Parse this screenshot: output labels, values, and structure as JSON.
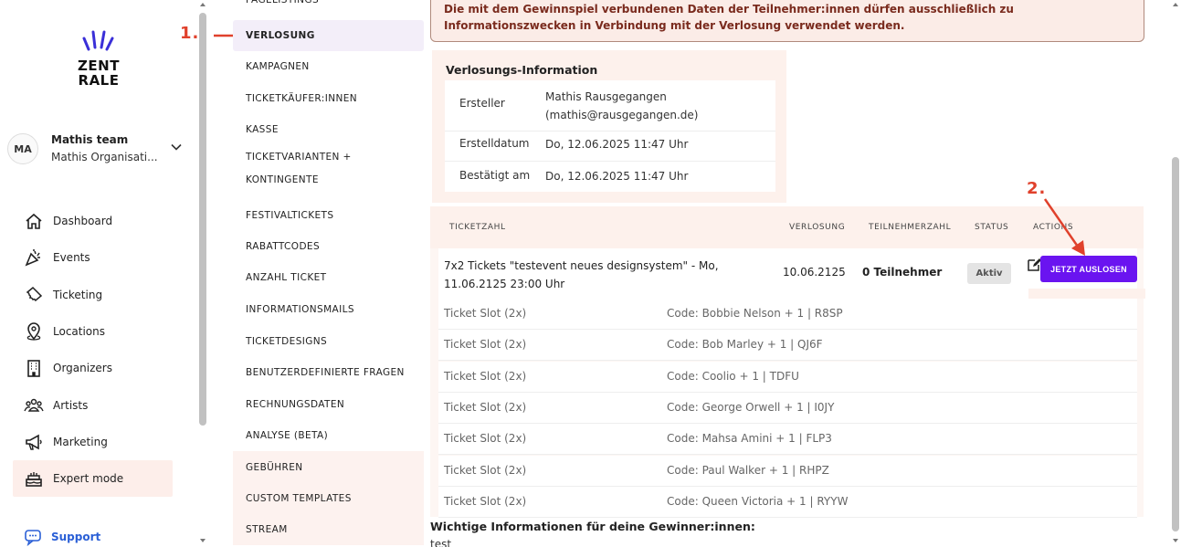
{
  "brand": {
    "logo_text": "ZENT\nRALE"
  },
  "team": {
    "initials": "MA",
    "name": "Mathis team",
    "org": "Mathis Organisati..."
  },
  "sidebar": {
    "items": [
      {
        "label": "Dashboard",
        "icon": "home-icon"
      },
      {
        "label": "Events",
        "icon": "party-icon"
      },
      {
        "label": "Ticketing",
        "icon": "ticket-icon"
      },
      {
        "label": "Locations",
        "icon": "location-pin-icon"
      },
      {
        "label": "Organizers",
        "icon": "building-icon"
      },
      {
        "label": "Artists",
        "icon": "group-icon"
      },
      {
        "label": "Marketing",
        "icon": "megaphone-icon"
      },
      {
        "label": "Expert mode",
        "icon": "cake-icon"
      }
    ],
    "support_label": "Support"
  },
  "submenu": {
    "items": [
      "PAGELISTINGS",
      "VERLOSUNG",
      "KAMPAGNEN",
      "TICKETKÄUFER:INNEN",
      "KASSE",
      "TICKETVARIANTEN + KONTINGENTE",
      "FESTIVALTICKETS",
      "RABATTCODES",
      "ANZAHL TICKET",
      "INFORMATIONSMAILS",
      "TICKETDESIGNS",
      "BENUTZERDEFINIERTE FRAGEN",
      "RECHNUNGSDATEN",
      "ANALYSE (BETA)",
      "GEBÜHREN",
      "CUSTOM TEMPLATES",
      "STREAM"
    ],
    "active": "VERLOSUNG"
  },
  "notice": {
    "text": "Die mit dem Gewinnspiel verbundenen Daten der Teilnehmer:innen dürfen ausschließlich zu Informationszwecken in Verbindung mit der Verlosung verwendet werden."
  },
  "info": {
    "title": "Verlosungs-Information",
    "rows": [
      {
        "key": "Ersteller",
        "value_line1": "Mathis Rausgegangen",
        "value_line2": "(mathis@rausgegangen.de)"
      },
      {
        "key": "Erstelldatum",
        "value_line1": "Do, 12.06.2025 11:47 Uhr"
      },
      {
        "key": "Bestätigt am",
        "value_line1": "Do, 12.06.2025 11:47 Uhr"
      }
    ]
  },
  "table": {
    "headers": {
      "ticket": "TICKETZAHL",
      "draw": "VERLOSUNG",
      "participants": "TEILNEHMERZAHL",
      "status": "STATUS",
      "actions": "ACTIONS"
    },
    "main_row": {
      "title": "7x2 Tickets \"testevent neues designsystem\" - Mo, 11.06.2125 23:00 Uhr",
      "draw_date": "10.06.2125",
      "participants": "0 Teilnehmer",
      "status": "Aktiv",
      "button": "JETZT AUSLOSEN"
    },
    "slots": [
      {
        "name": "Ticket Slot (2x)",
        "code": "Code: Bobbie Nelson + 1 | R8SP"
      },
      {
        "name": "Ticket Slot (2x)",
        "code": "Code: Bob Marley + 1 | QJ6F"
      },
      {
        "name": "Ticket Slot (2x)",
        "code": "Code: Coolio + 1 | TDFU"
      },
      {
        "name": "Ticket Slot (2x)",
        "code": "Code: George Orwell + 1 | I0JY"
      },
      {
        "name": "Ticket Slot (2x)",
        "code": "Code: Mahsa Amini + 1 | FLP3"
      },
      {
        "name": "Ticket Slot (2x)",
        "code": "Code: Paul Walker + 1 | RHPZ"
      },
      {
        "name": "Ticket Slot (2x)",
        "code": "Code: Queen Victoria + 1 | RYYW"
      }
    ]
  },
  "winner": {
    "title": "Wichtige Informationen für deine Gewinner:innen:",
    "text": "test"
  },
  "annotations": {
    "step1": "1.",
    "step2": "2."
  },
  "colors": {
    "accent": "#6a14f0",
    "annotation": "#e0412c",
    "active_bg": "#fdeeea"
  }
}
